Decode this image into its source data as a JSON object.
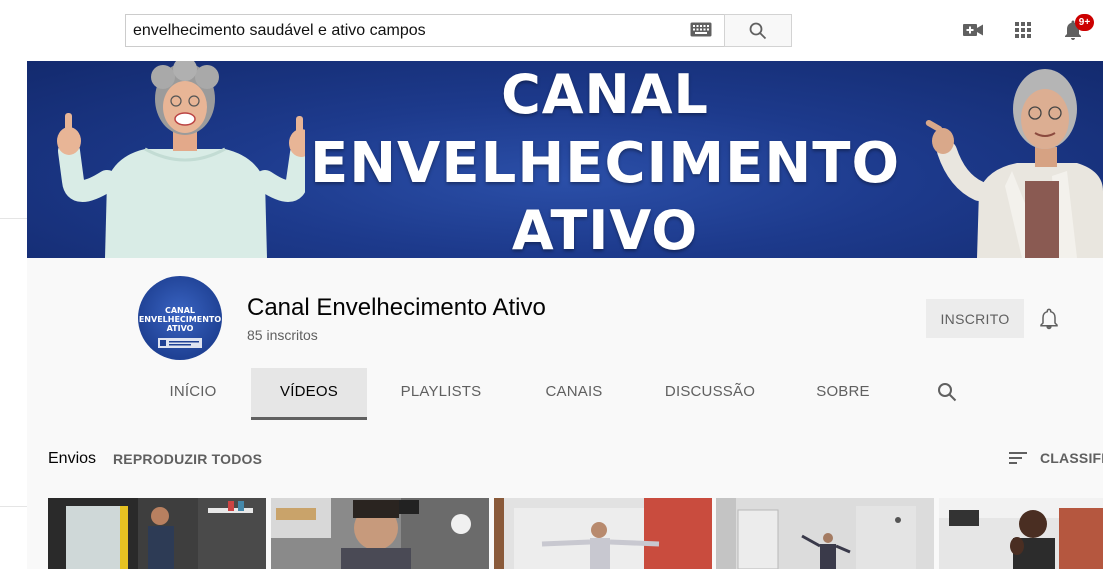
{
  "search": {
    "value": "envelhecimento saudável e ativo campos",
    "icons": [
      "keyboard-icon",
      "search-icon"
    ]
  },
  "topbar_icons": [
    "create-video-icon",
    "apps-grid-icon",
    "notifications-bell-icon"
  ],
  "notifications": {
    "badge": "9+"
  },
  "banner": {
    "line1": "CANAL",
    "line2": "ENVELHECIMENTO",
    "line3": "ATIVO"
  },
  "channel": {
    "avatar_line1": "CANAL",
    "avatar_line2": "ENVELHECIMENTO",
    "avatar_line3": "ATIVO",
    "name": "Canal Envelhecimento Ativo",
    "subscribers": "85 inscritos",
    "subscribed_label": "INSCRITO"
  },
  "tabs": [
    {
      "label": "INÍCIO",
      "active": false
    },
    {
      "label": "VÍDEOS",
      "active": true
    },
    {
      "label": "PLAYLISTS",
      "active": false
    },
    {
      "label": "CANAIS",
      "active": false
    },
    {
      "label": "DISCUSSÃO",
      "active": false
    },
    {
      "label": "SOBRE",
      "active": false
    }
  ],
  "uploads": {
    "title": "Envios",
    "play_all": "REPRODUZIR TODOS",
    "sort_label": "CLASSIFICAR"
  },
  "colors": {
    "banner_blue": "#1d3a8c",
    "badge_red": "#cc0000",
    "header_bg": "#f9f9f9"
  }
}
